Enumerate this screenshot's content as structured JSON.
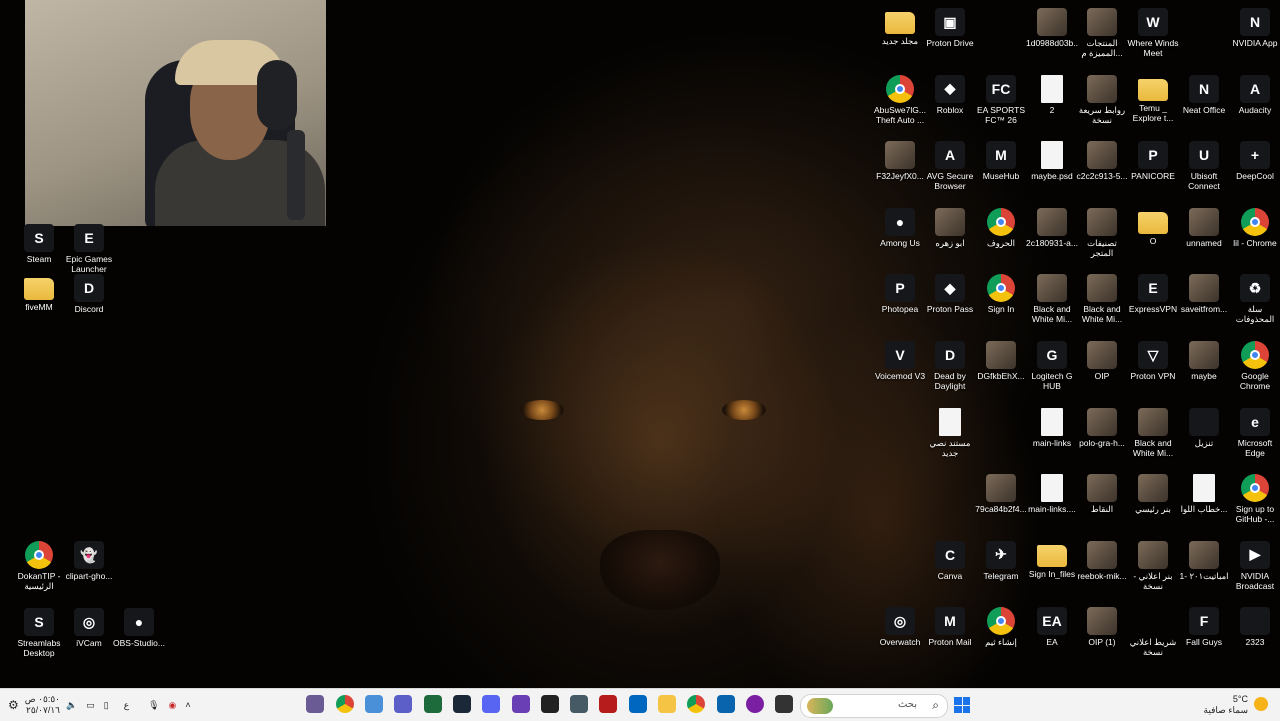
{
  "taskbar": {
    "time": "٠٥:٥٠ ص",
    "date": "٢٥/٠٧/١٦",
    "lang": "ع",
    "search_placeholder": "بحث",
    "weather_temp": "5°C",
    "weather_desc": "سماء صافية"
  },
  "desktop_left": [
    {
      "label": "Steam",
      "kind": "dark",
      "glyph": "S"
    },
    {
      "label": "Epic Games Launcher",
      "kind": "dark",
      "glyph": "E"
    },
    {
      "label": "fiveMM",
      "kind": "folder",
      "glyph": ""
    },
    {
      "label": "Discord",
      "kind": "dark",
      "glyph": "D"
    },
    {
      "label": "DokanTIP - الرئيسية",
      "kind": "chrome",
      "glyph": ""
    },
    {
      "label": "clipart-gho...",
      "kind": "dark",
      "glyph": "👻"
    },
    {
      "label": "Streamlabs Desktop",
      "kind": "dark",
      "glyph": "S"
    },
    {
      "label": "iVCam",
      "kind": "dark",
      "glyph": "◎"
    },
    {
      "label": "OBS-Studio...",
      "kind": "dark",
      "glyph": "●"
    }
  ],
  "desktop_right": [
    [
      {
        "label": "مجلد جديد",
        "kind": "folder",
        "glyph": ""
      },
      {
        "label": "Proton Drive",
        "kind": "dark",
        "glyph": "▣"
      },
      {
        "label": "",
        "kind": "none",
        "glyph": ""
      },
      {
        "label": "1d0988d03b...",
        "kind": "img",
        "glyph": ""
      },
      {
        "label": "المنتجات المميزة م...",
        "kind": "img",
        "glyph": ""
      },
      {
        "label": "Where Winds Meet",
        "kind": "dark",
        "glyph": "W"
      },
      {
        "label": "",
        "kind": "none",
        "glyph": ""
      },
      {
        "label": "NVIDIA App",
        "kind": "dark",
        "glyph": "N"
      }
    ],
    [
      {
        "label": "AbuSwe7lG... Theft Auto ...",
        "kind": "chrome",
        "glyph": ""
      },
      {
        "label": "Roblox",
        "kind": "dark",
        "glyph": "◆"
      },
      {
        "label": "EA SPORTS FC™ 26",
        "kind": "dark",
        "glyph": "FC"
      },
      {
        "label": "2",
        "kind": "doc",
        "glyph": ""
      },
      {
        "label": "روابط سريعة نسخة",
        "kind": "img",
        "glyph": ""
      },
      {
        "label": "Temu _ Explore t...",
        "kind": "folder",
        "glyph": ""
      },
      {
        "label": "Neat Office",
        "kind": "dark",
        "glyph": "N"
      },
      {
        "label": "Audacity",
        "kind": "dark",
        "glyph": "A"
      }
    ],
    [
      {
        "label": "F32JeyfX0...",
        "kind": "img",
        "glyph": ""
      },
      {
        "label": "AVG Secure Browser",
        "kind": "dark",
        "glyph": "A"
      },
      {
        "label": "MuseHub",
        "kind": "dark",
        "glyph": "M"
      },
      {
        "label": "maybe.psd",
        "kind": "doc",
        "glyph": ""
      },
      {
        "label": "c2c2c913-5...",
        "kind": "img",
        "glyph": ""
      },
      {
        "label": "PANICORE",
        "kind": "dark",
        "glyph": "P"
      },
      {
        "label": "Ubisoft Connect",
        "kind": "dark",
        "glyph": "U"
      },
      {
        "label": "DeepCool",
        "kind": "dark",
        "glyph": "+"
      }
    ],
    [
      {
        "label": "Among Us",
        "kind": "dark",
        "glyph": "●"
      },
      {
        "label": "ابو زهره",
        "kind": "img",
        "glyph": ""
      },
      {
        "label": "الحروف",
        "kind": "chrome",
        "glyph": ""
      },
      {
        "label": "2c180931-a...",
        "kind": "img",
        "glyph": ""
      },
      {
        "label": "تصنيفات المتجر",
        "kind": "img",
        "glyph": ""
      },
      {
        "label": "O",
        "kind": "folder",
        "glyph": ""
      },
      {
        "label": "unnamed",
        "kind": "img",
        "glyph": ""
      },
      {
        "label": "lil - Chrome",
        "kind": "chrome",
        "glyph": ""
      }
    ],
    [
      {
        "label": "Photopea",
        "kind": "dark",
        "glyph": "P"
      },
      {
        "label": "Proton Pass",
        "kind": "dark",
        "glyph": "◆"
      },
      {
        "label": "Sign In",
        "kind": "chrome",
        "glyph": ""
      },
      {
        "label": "Black and White Mi...",
        "kind": "img",
        "glyph": ""
      },
      {
        "label": "Black and White Mi...",
        "kind": "img",
        "glyph": ""
      },
      {
        "label": "ExpressVPN",
        "kind": "dark",
        "glyph": "E"
      },
      {
        "label": "saveitfrom...",
        "kind": "img",
        "glyph": ""
      },
      {
        "label": "سلة المحذوفات",
        "kind": "dark",
        "glyph": "♻"
      }
    ],
    [
      {
        "label": "Voicemod V3",
        "kind": "dark",
        "glyph": "V"
      },
      {
        "label": "Dead by Daylight",
        "kind": "dark",
        "glyph": "D"
      },
      {
        "label": "DGfkbEhX...",
        "kind": "img",
        "glyph": ""
      },
      {
        "label": "Logitech G HUB",
        "kind": "dark",
        "glyph": "G"
      },
      {
        "label": "OIP",
        "kind": "img",
        "glyph": ""
      },
      {
        "label": "Proton VPN",
        "kind": "dark",
        "glyph": "▽"
      },
      {
        "label": "maybe",
        "kind": "img",
        "glyph": ""
      },
      {
        "label": "Google Chrome",
        "kind": "chrome",
        "glyph": ""
      }
    ],
    [
      {
        "label": "",
        "kind": "none",
        "glyph": ""
      },
      {
        "label": "مستند نصي جديد",
        "kind": "doc",
        "glyph": ""
      },
      {
        "label": "",
        "kind": "none",
        "glyph": ""
      },
      {
        "label": "main-links",
        "kind": "doc",
        "glyph": ""
      },
      {
        "label": "polo-gra-h...",
        "kind": "img",
        "glyph": ""
      },
      {
        "label": "Black and White Mi...",
        "kind": "img",
        "glyph": ""
      },
      {
        "label": "تنزيل",
        "kind": "dark",
        "glyph": ""
      },
      {
        "label": "Microsoft Edge",
        "kind": "dark",
        "glyph": "e"
      }
    ],
    [
      {
        "label": "",
        "kind": "none",
        "glyph": ""
      },
      {
        "label": "",
        "kind": "none",
        "glyph": ""
      },
      {
        "label": "79ca84b2f4...",
        "kind": "img",
        "glyph": ""
      },
      {
        "label": "main-links....",
        "kind": "doc",
        "glyph": ""
      },
      {
        "label": "النقاط",
        "kind": "img",
        "glyph": ""
      },
      {
        "label": "بنر رئيسي",
        "kind": "img",
        "glyph": ""
      },
      {
        "label": "خطاب اللوا...",
        "kind": "doc",
        "glyph": ""
      },
      {
        "label": "Sign up to GitHub -...",
        "kind": "chrome",
        "glyph": ""
      }
    ],
    [
      {
        "label": "",
        "kind": "none",
        "glyph": ""
      },
      {
        "label": "Canva",
        "kind": "dark",
        "glyph": "C"
      },
      {
        "label": "Telegram",
        "kind": "dark",
        "glyph": "✈"
      },
      {
        "label": "Sign In_files",
        "kind": "folder",
        "glyph": ""
      },
      {
        "label": "reebok-mik...",
        "kind": "img",
        "glyph": ""
      },
      {
        "label": "بنر اعلاني - نسخة",
        "kind": "img",
        "glyph": ""
      },
      {
        "label": "امباتيت٢٠١ -1",
        "kind": "img",
        "glyph": ""
      },
      {
        "label": "NVIDIA Broadcast",
        "kind": "dark",
        "glyph": "▶"
      }
    ],
    [
      {
        "label": "Overwatch",
        "kind": "dark",
        "glyph": "◎"
      },
      {
        "label": "Proton Mail",
        "kind": "dark",
        "glyph": "M"
      },
      {
        "label": "إنشاء ثيم",
        "kind": "chrome",
        "glyph": ""
      },
      {
        "label": "EA",
        "kind": "dark",
        "glyph": "EA"
      },
      {
        "label": "OIP (1)",
        "kind": "img",
        "glyph": ""
      },
      {
        "label": "شريط اعلاني نسخة",
        "kind": "none",
        "glyph": ""
      },
      {
        "label": "Fall Guys",
        "kind": "dark",
        "glyph": "F"
      },
      {
        "label": "2323",
        "kind": "dark",
        "glyph": ""
      }
    ]
  ],
  "colors": {
    "desktop_bg": "#050403",
    "taskbar_bg": "#f3f3f3",
    "accent": "#1a73e8"
  }
}
